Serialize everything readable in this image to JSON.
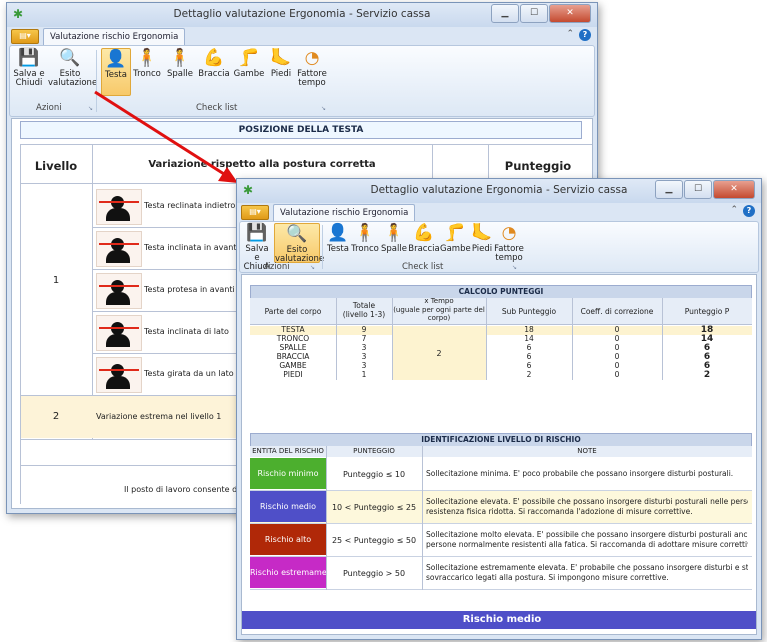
{
  "window_back": {
    "title": "Dettaglio valutazione Ergonomia - Servizio cassa",
    "tab_label": "Valutazione rischio Ergonomia",
    "group_actions": "Azioni",
    "group_checklist": "Check list",
    "btn_save": [
      "Salva e",
      "Chiudi"
    ],
    "btn_esito": [
      "Esito",
      "valutazione"
    ],
    "checklist": [
      "Testa",
      "Tronco",
      "Spalle",
      "Braccia",
      "Gambe",
      "Piedi"
    ],
    "btn_fattore": [
      "Fattore",
      "tempo"
    ],
    "section_title": "POSIZIONE DELLA TESTA",
    "col_level": "Livello",
    "col_variation": "Variazione rispetto alla postura corretta",
    "col_score": "Punteggio",
    "level1": "1",
    "level2": "2",
    "rows": [
      "Testa reclinata indietro, d",
      "Testa inclinata in avanti d",
      "Testa protesa in avanti",
      "Testa inclinata di lato",
      "Testa girata da un lato di"
    ],
    "level2_text": "Variazione estrema nel livello 1",
    "footer_text": "Il posto di lavoro consente di assu"
  },
  "window_front": {
    "title": "Dettaglio valutazione Ergonomia - Servizio cassa",
    "tab_label": "Valutazione rischio Ergonomia",
    "group_actions": "Azioni",
    "group_checklist": "Check list",
    "btn_save": [
      "Salva e",
      "Chiudi"
    ],
    "btn_esito": [
      "Esito",
      "valutazione"
    ],
    "checklist": [
      "Testa",
      "Tronco",
      "Spalle",
      "Braccia",
      "Gambe",
      "Piedi"
    ],
    "btn_fattore": [
      "Fattore",
      "tempo"
    ],
    "calc": {
      "title": "CALCOLO PUNTEGGI",
      "headers": [
        "Parte del corpo",
        "Totale\n(livello 1-3)",
        "x Tempo\n(uguale per ogni parte del\ncorpo)",
        "Sub Punteggio",
        "Coeff. di correzione",
        "Punteggio P"
      ],
      "time_value": "2",
      "rows": [
        [
          "TESTA",
          "9",
          "18",
          "0",
          "18"
        ],
        [
          "TRONCO",
          "7",
          "14",
          "0",
          "14"
        ],
        [
          "SPALLE",
          "3",
          "6",
          "0",
          "6"
        ],
        [
          "BRACCIA",
          "3",
          "6",
          "0",
          "6"
        ],
        [
          "GAMBE",
          "3",
          "6",
          "0",
          "6"
        ],
        [
          "PIEDI",
          "1",
          "2",
          "0",
          "2"
        ]
      ]
    },
    "risk": {
      "title": "IDENTIFICAZIONE LIVELLO DI RISCHIO",
      "headers": [
        "ENTITA DEL RISCHIO",
        "PUNTEGGIO",
        "NOTE"
      ],
      "rows": [
        {
          "label": "Rischio minimo",
          "score": "Punteggio ≤ 10",
          "color": "#4caf2e",
          "note": [
            "Sollecitazione minima. E' poco probabile che possano insorgere disturbi posturali."
          ]
        },
        {
          "label": "Rischio medio",
          "score": "10 < Punteggio ≤ 25",
          "color": "#4f4fc8",
          "note": [
            "Sollecitazione elevata. E' possibile che possano insorgere disturbi posturali nelle persone con una",
            "resistenza fisica ridotta. Si raccomanda l'adozione di misure correttive."
          ]
        },
        {
          "label": "Rischio alto",
          "score": "25 < Punteggio ≤ 50",
          "color": "#b02808",
          "note": [
            "Sollecitazione molto elevata. E' possibile che possano insorgere disturbi posturali anche nelle",
            "persone normalmente resistenti alla fatica. Si raccomanda di adottare misure correttive immediate."
          ]
        },
        {
          "label": "Rischio estremamente ...",
          "score": "Punteggio > 50",
          "color": "#c62ac6",
          "note": [
            "Sollecitazione estremamente elevata. E' probabile che possano insorgere disturbi e stati di",
            "sovraccarico legati alla postura. Si impongono misure correttive."
          ]
        }
      ]
    },
    "result": "Rischio medio"
  }
}
